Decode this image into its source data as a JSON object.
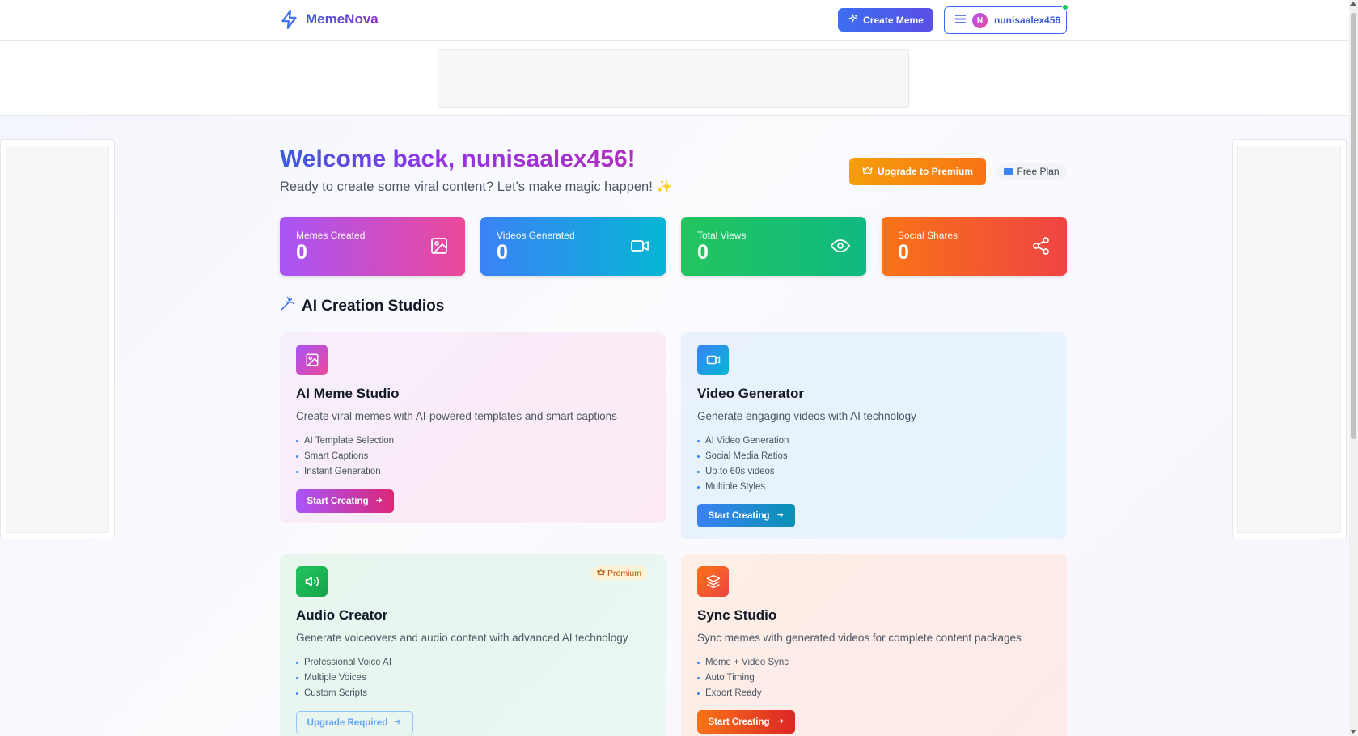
{
  "header": {
    "logo_text": "MemeNova",
    "create_button": "Create Meme",
    "user": {
      "initial": "N",
      "name": "nunisaalex456"
    }
  },
  "welcome": {
    "title": "Welcome back, nunisaalex456!",
    "subtitle": "Ready to create some viral content? Let's make magic happen! ✨",
    "upgrade_button": "Upgrade to Premium",
    "plan_badge": "Free Plan"
  },
  "stats": [
    {
      "label": "Memes Created",
      "value": "0",
      "icon": "image-icon",
      "gradient": [
        "#a855f7",
        "#ec4899"
      ]
    },
    {
      "label": "Videos Generated",
      "value": "0",
      "icon": "video-icon",
      "gradient": [
        "#3b82f6",
        "#06b6d4"
      ]
    },
    {
      "label": "Total Views",
      "value": "0",
      "icon": "eye-icon",
      "gradient": [
        "#22c55e",
        "#10b981"
      ]
    },
    {
      "label": "Social Shares",
      "value": "0",
      "icon": "share-icon",
      "gradient": [
        "#f97316",
        "#ef4444"
      ]
    }
  ],
  "section_title": "AI Creation Studios",
  "studios": [
    {
      "title": "AI Meme Studio",
      "description": "Create viral memes with AI-powered templates and smart captions",
      "features": [
        "AI Template Selection",
        "Smart Captions",
        "Instant Generation"
      ],
      "button": "Start Creating",
      "icon": "image-icon"
    },
    {
      "title": "Video Generator",
      "description": "Generate engaging videos with AI technology",
      "features": [
        "AI Video Generation",
        "Social Media Ratios",
        "Up to 60s videos",
        "Multiple Styles"
      ],
      "button": "Start Creating",
      "icon": "video-icon"
    },
    {
      "title": "Audio Creator",
      "description": "Generate voiceovers and audio content with advanced AI technology",
      "features": [
        "Professional Voice AI",
        "Multiple Voices",
        "Custom Scripts"
      ],
      "button": "Upgrade Required",
      "badge": "Premium",
      "icon": "speaker-icon"
    },
    {
      "title": "Sync Studio",
      "description": "Sync memes with generated videos for complete content packages",
      "features": [
        "Meme + Video Sync",
        "Auto Timing",
        "Export Ready"
      ],
      "button": "Start Creating",
      "icon": "layers-icon"
    }
  ],
  "colors": {
    "primary": "#3b6ef0",
    "meme_accent": "#a855f7",
    "video_accent": "#3b82f6",
    "audio_accent": "#22c55e",
    "sync_accent": "#f97316",
    "premium": "#f59e0b"
  }
}
